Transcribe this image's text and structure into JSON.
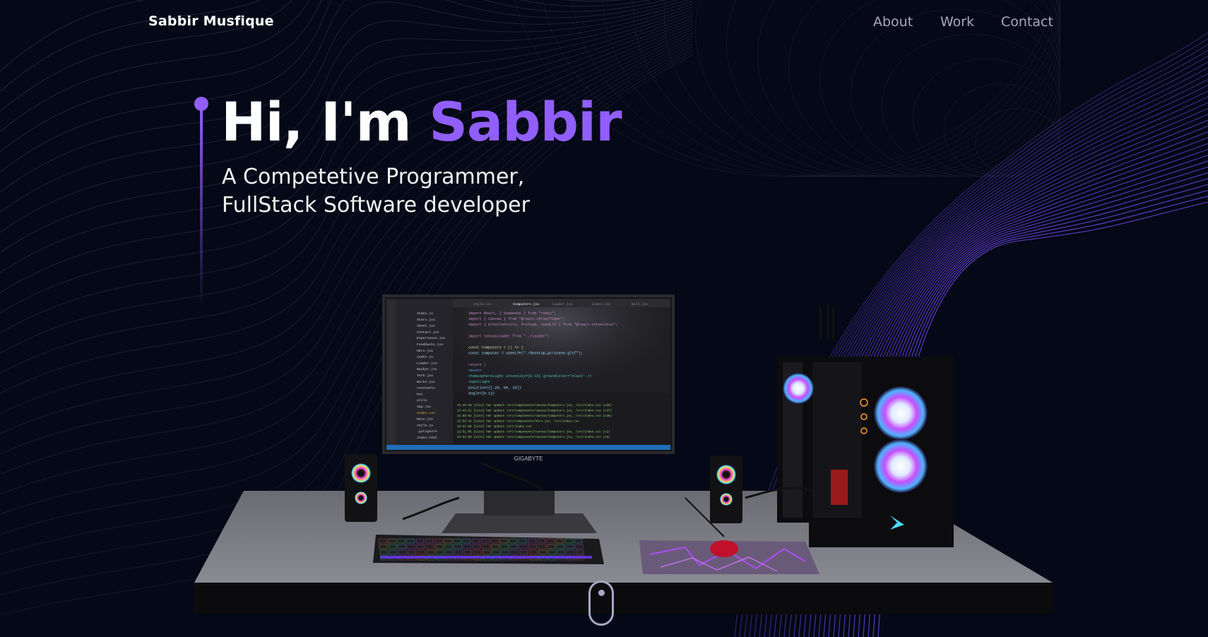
{
  "nav": {
    "brand": "Sabbir  Musfique",
    "links": [
      "About",
      "Work",
      "Contact"
    ]
  },
  "hero": {
    "greeting": "Hi, I'm ",
    "name": "Sabbir",
    "subtitle_line1": "A Competetive Programmer,",
    "subtitle_line2": "FullStack Software developer"
  },
  "scene": {
    "monitor_brand": "GIGABYTE",
    "editor_tabs": [
      "style.css",
      "Computers.jsx",
      "Loader.jsx",
      "index.jsx",
      "Ball.jsx"
    ],
    "code_lines": [
      "import React, { Suspense } from \"react\";",
      "import { Canvas } from \"@react-three/fiber\";",
      "import { OrbitControls, Preload, useGLTF } from \"@react-three/drei\";",
      "",
      "import CanvasLoader from \"../Loader\";",
      "",
      "const Computers = () => {",
      "  const computer = useGLTF(\"./desktop_pc/scene.gltf\");",
      "",
      "  return (",
      "    <mesh>",
      "      <hemisphereLight intensity={0.15} groundColor='black' />",
      "      <spotLight",
      "        position={[-20, 50, 10]}",
      "        angle={0.12}"
    ],
    "file_tree": [
      "Index.js",
      "Stars.jsx",
      "About.jsx",
      "Contact.jsx",
      "Experience.jsx",
      "Feedbacks.jsx",
      "Hero.jsx",
      "index.js",
      "Loader.jsx",
      "Navbar.jsx",
      "Tech.jsx",
      "Works.jsx",
      "constants",
      "hoc",
      "utils",
      "App.jsx",
      "index.css",
      "main.jsx",
      "style.js",
      ".gitignore",
      "index.html"
    ],
    "terminal_lines": [
      "22:49:40 [vite] hmr update /src/components/canvas/Computers.jsx, /src/index.css (x35)",
      "22:49:51 [vite] hmr update /src/components/canvas/Computers.jsx, /src/index.css (x37)",
      "22:50:02 [vite] hmr update /src/components/canvas/Computers.jsx, /src/index.css (x38)",
      "22:50:42 [vite] hmr update /src/components/Hero.jsx, /src/index.css",
      "22:51:06 [vite] hmr update /src/index.css",
      "22:51:06 [vite] hmr update /src/components/canvas/Computers.jsx, /src/index.css (x2)",
      "22:52:09 [vite] hmr update /src/components/canvas/Computers.jsx, /src/index.css (x3)"
    ],
    "colors": {
      "accent": "#915eff",
      "background": "#050816",
      "link": "#aaa6c3"
    }
  },
  "icons": [
    "mouse-scroll-icon"
  ]
}
